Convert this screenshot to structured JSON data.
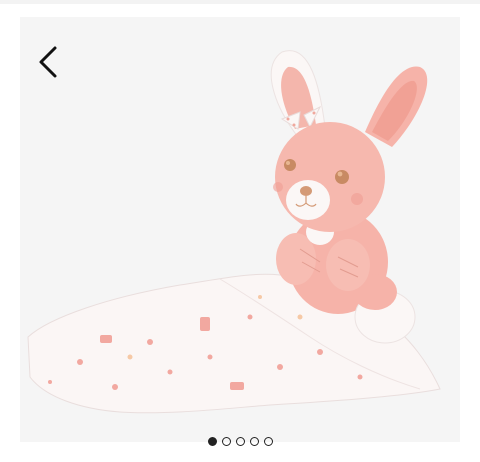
{
  "header": {
    "back_icon": "chevron-left-icon"
  },
  "gallery": {
    "image_subject": "pink-bunny-plush-with-blanket",
    "slide_count": 5,
    "active_slide": 1
  },
  "colors": {
    "background": "#f5f5f5",
    "plush_pink": "#f6b7ad",
    "blanket": "#fbf7f6",
    "dot": "#222222"
  }
}
